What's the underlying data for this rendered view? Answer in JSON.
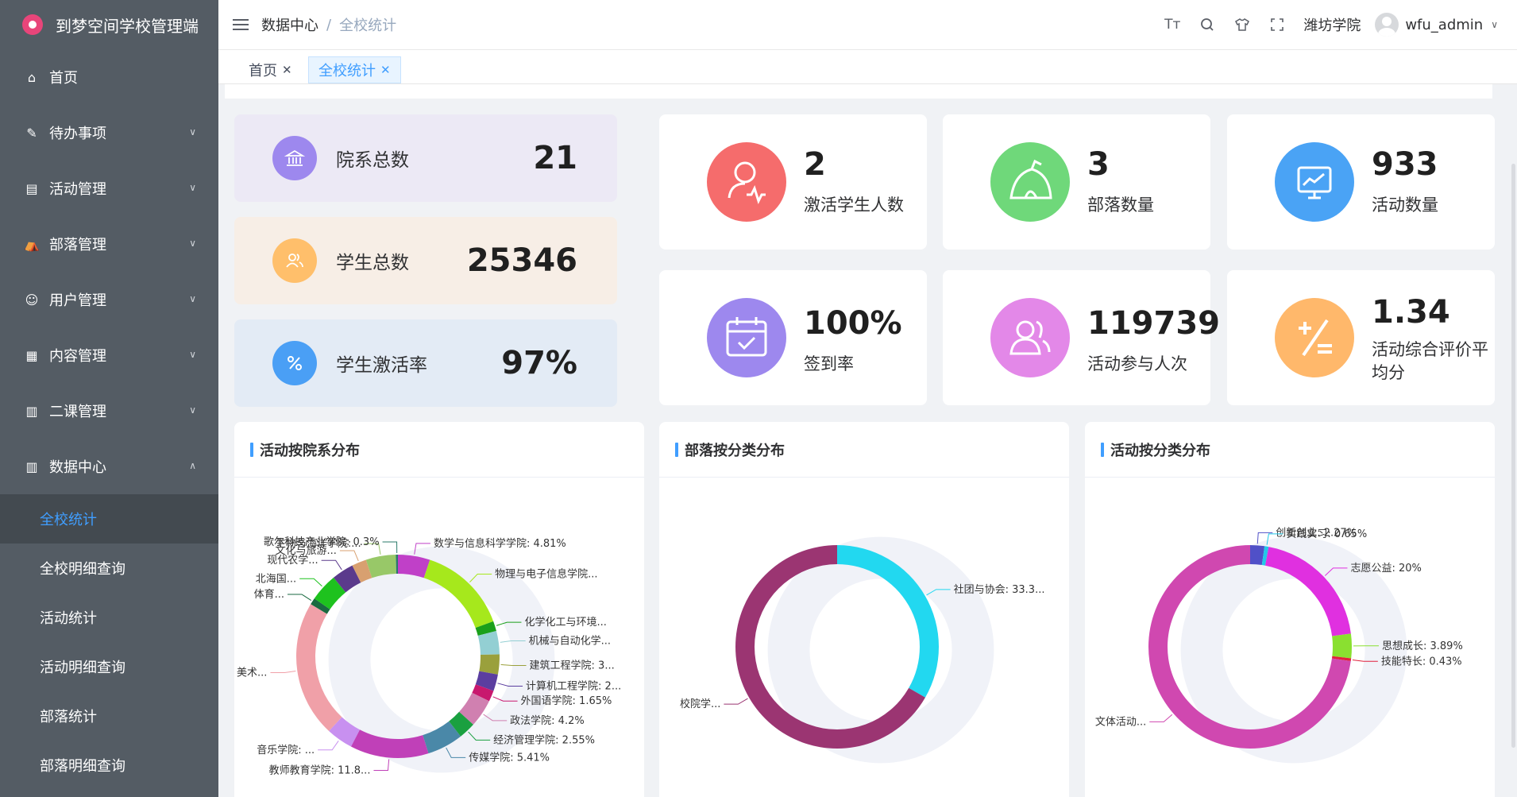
{
  "app": {
    "title": "到梦空间学校管理端"
  },
  "sidebar": {
    "items": [
      {
        "label": "首页",
        "icon": "home-icon"
      },
      {
        "label": "待办事项",
        "icon": "edit-icon"
      },
      {
        "label": "活动管理",
        "icon": "document-icon"
      },
      {
        "label": "部落管理",
        "icon": "tent-icon"
      },
      {
        "label": "用户管理",
        "icon": "user-icon"
      },
      {
        "label": "内容管理",
        "icon": "file-icon"
      },
      {
        "label": "二课管理",
        "icon": "book-icon"
      },
      {
        "label": "数据中心",
        "icon": "chart-icon"
      }
    ],
    "sub_items": [
      "全校统计",
      "全校明细查询",
      "活动统计",
      "活动明细查询",
      "部落统计",
      "部落明细查询"
    ]
  },
  "header": {
    "breadcrumb": [
      "数据中心",
      "全校统计"
    ],
    "separator": "/",
    "school": "潍坊学院",
    "username": "wfu_admin",
    "font_size_glyph": "Tт"
  },
  "tags": [
    {
      "label": "首页"
    },
    {
      "label": "全校统计"
    }
  ],
  "left_cards": [
    {
      "label": "院系总数",
      "value": "21",
      "icon": "building-icon",
      "color": "#9d88ee",
      "bg": "#ece9f5"
    },
    {
      "label": "学生总数",
      "value": "25346",
      "icon": "users-icon",
      "color": "#ffbf6b",
      "bg": "#f7eee6"
    },
    {
      "label": "学生激活率",
      "value": "97%",
      "icon": "percent-icon",
      "color": "#4a9ff5",
      "bg": "#e3ebf5"
    }
  ],
  "right_cards": [
    {
      "value": "2",
      "label": "激活学生人数",
      "icon": "active-user-icon",
      "color": "#f56c6c"
    },
    {
      "value": "3",
      "label": "部落数量",
      "icon": "tent-icon",
      "color": "#6fd87a"
    },
    {
      "value": "933",
      "label": "活动数量",
      "icon": "monitor-chart-icon",
      "color": "#4aa3f5"
    },
    {
      "value": "100%",
      "label": "签到率",
      "icon": "calendar-check-icon",
      "color": "#9d88ee"
    },
    {
      "value": "119739",
      "label": "活动参与人次",
      "icon": "group-icon",
      "color": "#e388e8"
    },
    {
      "value": "1.34",
      "label": "活动综合评价平均分",
      "icon": "calculator-icon",
      "color": "#ffb86b"
    }
  ],
  "panels": [
    {
      "title": "活动按院系分布"
    },
    {
      "title": "部落按分类分布"
    },
    {
      "title": "活动按分类分布"
    }
  ],
  "chart_data": [
    {
      "type": "pie",
      "title": "活动按院系分布",
      "slices": [
        {
          "label": "数学与信息科学学院: 4.81%",
          "value": 4.81,
          "color": "#c040c8"
        },
        {
          "label": "物理与电子信息学院...",
          "value": 13.5,
          "color": "#a6e81c"
        },
        {
          "label": "化学化工与环境...",
          "value": 1.5,
          "color": "#1aa01a"
        },
        {
          "label": "机械与自动化学...",
          "value": 3.5,
          "color": "#93cfd3"
        },
        {
          "label": "建筑工程学院: 3...",
          "value": 3.0,
          "color": "#9aa03c"
        },
        {
          "label": "计算机工程学院: 2...",
          "value": 2.5,
          "color": "#5b3ea0"
        },
        {
          "label": "外国语学院: 1.65%",
          "value": 1.65,
          "color": "#c8186e"
        },
        {
          "label": "政法学院: 4.2%",
          "value": 4.2,
          "color": "#d080b0"
        },
        {
          "label": "经济管理学院: 2.55%",
          "value": 2.55,
          "color": "#1aa040"
        },
        {
          "label": "传媒学院: 5.41%",
          "value": 5.41,
          "color": "#4a88a8"
        },
        {
          "label": "教师教育学院: 11.8...",
          "value": 11.8,
          "color": "#c040b8"
        },
        {
          "label": "音乐学院: ...",
          "value": 4.0,
          "color": "#c890f0"
        },
        {
          "label": "美术...",
          "value": 20.5,
          "color": "#f0a0a8"
        },
        {
          "label": "体育...",
          "value": 1.0,
          "color": "#1a6a40"
        },
        {
          "label": "北海国...",
          "value": 4.2,
          "color": "#1ec21e"
        },
        {
          "label": "现代农学...",
          "value": 3.3,
          "color": "#5b3a8c"
        },
        {
          "label": "文化与旅游...",
          "value": 2.2,
          "color": "#d8a070"
        },
        {
          "label": "生物与海洋学院:...",
          "value": 4.5,
          "color": "#98c868"
        },
        {
          "label": "歌尔科技产业学院: 0.3%",
          "value": 0.3,
          "color": "#2a7a6a"
        }
      ]
    },
    {
      "type": "pie",
      "title": "部落按分类分布",
      "slices": [
        {
          "label": "社团与协会: 33.3...",
          "value": 33.3,
          "color": "#22d8f0"
        },
        {
          "label": "校院学...",
          "value": 66.7,
          "color": "#9b3572"
        }
      ]
    },
    {
      "type": "pie",
      "title": "活动按分类分布",
      "slices": [
        {
          "label": "创新创业: 2.27%",
          "value": 2.27,
          "color": "#5050c8"
        },
        {
          "label": "实践实习: 0.65%",
          "value": 0.65,
          "color": "#22c8e8"
        },
        {
          "label": "志愿公益: 20%",
          "value": 20,
          "color": "#e030e0"
        },
        {
          "label": "思想成长: 3.89%",
          "value": 3.89,
          "color": "#8ae030"
        },
        {
          "label": "技能特长: 0.43%",
          "value": 0.43,
          "color": "#e0203c"
        },
        {
          "label": "文体活动...",
          "value": 72.76,
          "color": "#d048b0"
        }
      ]
    }
  ]
}
